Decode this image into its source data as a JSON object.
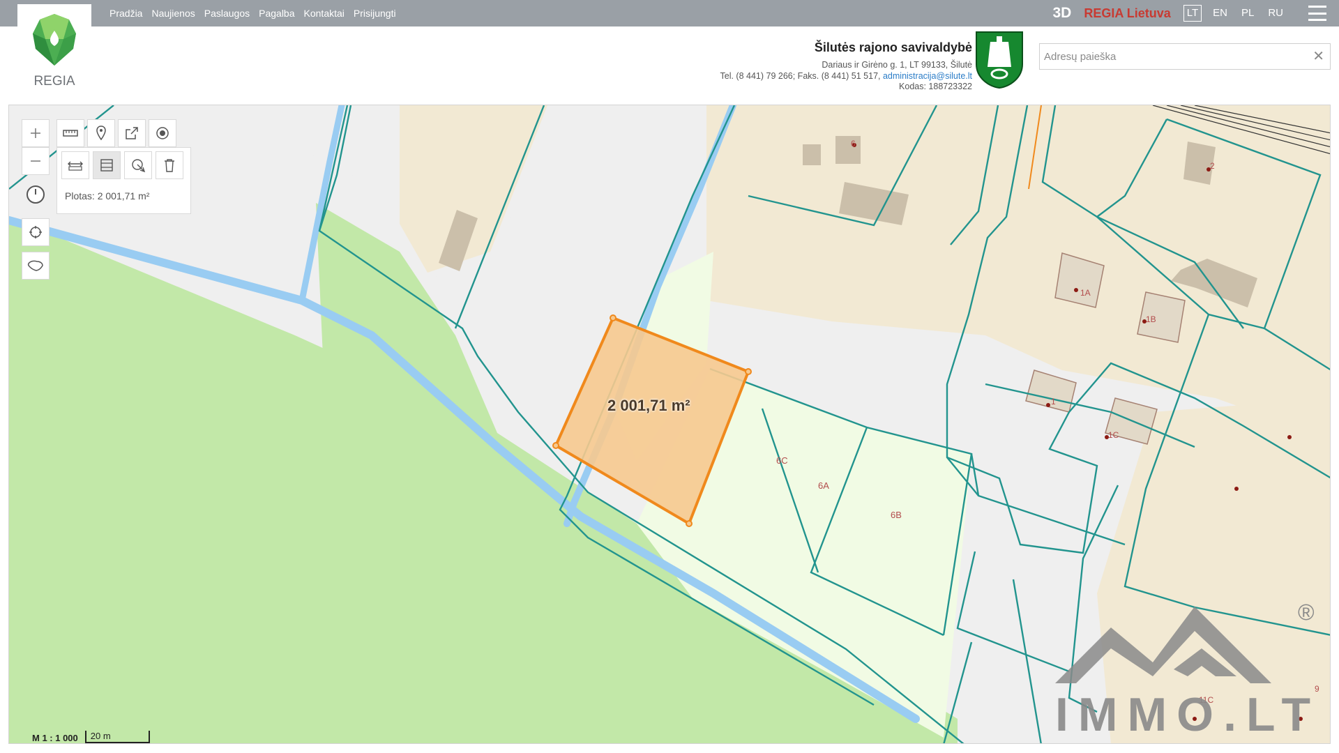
{
  "nav": {
    "items": [
      "Pradžia",
      "Naujienos",
      "Paslaugos",
      "Pagalba",
      "Kontaktai",
      "Prisijungti"
    ]
  },
  "top_right": {
    "mode_3d": "3D",
    "portal": "REGIA Lietuva",
    "languages": [
      "LT",
      "EN",
      "PL",
      "RU"
    ],
    "active_language": "LT"
  },
  "logo": {
    "text": "REGIA"
  },
  "municipality": {
    "name": "Šilutės rajono savivaldybė",
    "address": "Dariaus ir Girėno g. 1, LT 99133, Šilutė",
    "phones": "Tel. (8 441) 79 266; Faks. (8 441) 51 517,",
    "email": "administracija@silute.lt",
    "code": "Kodas: 188723322"
  },
  "search": {
    "placeholder": "Adresų paieška",
    "value": ""
  },
  "measure": {
    "result": "Plotas: 2 001,71 m²",
    "area_label": "2 001,71 m²"
  },
  "parcel_labels": {
    "n6": "6",
    "n2": "2",
    "n1a": "1A",
    "n1b": "1B",
    "n1": "1",
    "n1c": "1C",
    "n6c": "6C",
    "n6a": "6A",
    "n6b": "6B",
    "n11c": "11C",
    "n9": "9"
  },
  "scale": {
    "ratio": "M 1 : 1 000",
    "bar": "20 m"
  },
  "watermark": {
    "text": "IMMO.LT",
    "registered": "®"
  },
  "colors": {
    "topbar": "#9aa0a6",
    "parcel_line": "#22948e",
    "water": "#99ccf2",
    "forest": "#c2e8a8",
    "built_area": "#f2e9d3",
    "building": "#cbbfaa",
    "measure_fill": "#f6c98f",
    "measure_line": "#f0891c",
    "regia_red": "#c83a32"
  },
  "icons": [
    "zoom-in-icon",
    "zoom-out-icon",
    "ruler-icon",
    "pin-icon",
    "export-icon",
    "target-icon",
    "measure-distance-icon",
    "measure-area-icon",
    "reset-measure-icon",
    "trash-icon",
    "history-icon",
    "locate-icon",
    "lithuania-icon",
    "close-icon",
    "menu-icon"
  ]
}
